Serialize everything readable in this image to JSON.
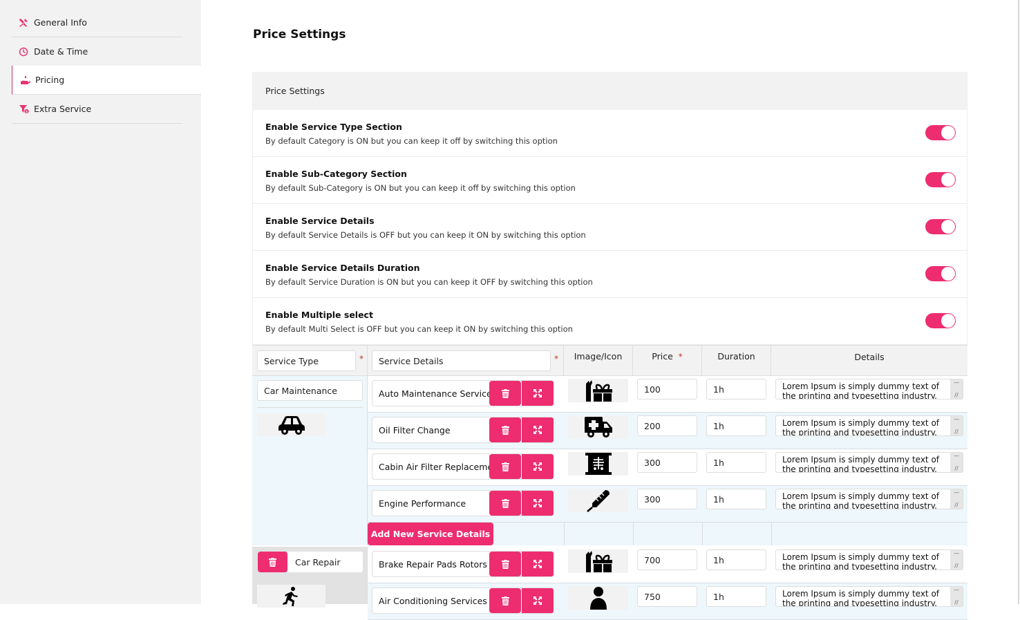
{
  "sidebar": {
    "items": [
      {
        "label": "General Info",
        "icon": "tools-icon",
        "active": false
      },
      {
        "label": "Date & Time",
        "icon": "clock-icon",
        "active": false
      },
      {
        "label": "Pricing",
        "icon": "hand-coin-icon",
        "active": true
      },
      {
        "label": "Extra Service",
        "icon": "funnel-dollar-icon",
        "active": false
      }
    ]
  },
  "page": {
    "title": "Price Settings"
  },
  "panel": {
    "title": "Price Settings",
    "options": [
      {
        "title": "Enable Service Type Section",
        "desc": "By default Category is ON but you can keep it off by switching this option",
        "on": true
      },
      {
        "title": "Enable Sub-Category Section",
        "desc": "By default Sub-Category is ON but you can keep it off by switching this option",
        "on": true
      },
      {
        "title": "Enable Service Details",
        "desc": "By default Service Details is OFF but you can keep it ON by switching this option",
        "on": true
      },
      {
        "title": "Enable Service Details Duration",
        "desc": "By default Service Duration is ON but you can keep it OFF by switching this option",
        "on": true
      },
      {
        "title": "Enable Multiple select",
        "desc": "By default Multi Select is OFF but you can keep it ON by switching this option",
        "on": true
      }
    ]
  },
  "table": {
    "headers": {
      "service_type": "Service Type",
      "service_details": "Service Details",
      "image": "Image/Icon",
      "price": "Price",
      "duration": "Duration",
      "details": "Details",
      "required_mark": "*"
    },
    "add_label": "Add New Service Details",
    "groups": [
      {
        "type": "Car Maintenance",
        "icon": "car-icon",
        "rows": [
          {
            "name": "Auto Maintenance Services",
            "icon": "gifts-icon",
            "price": "100",
            "duration": "1h",
            "details": "Lorem Ipsum is simply dummy text of the printing and typesetting industry."
          },
          {
            "name": "Oil Filter Change",
            "icon": "ambulance-icon",
            "price": "200",
            "duration": "1h",
            "details": "Lorem Ipsum is simply dummy text of the printing and typesetting industry."
          },
          {
            "name": "Cabin Air Filter Replacement",
            "icon": "x-ray-icon",
            "price": "300",
            "duration": "1h",
            "details": "Lorem Ipsum is simply dummy text of the printing and typesetting industry."
          },
          {
            "name": "Engine Performance",
            "icon": "thermometer-icon",
            "price": "300",
            "duration": "1h",
            "details": "Lorem Ipsum is simply dummy text of the printing and typesetting industry."
          }
        ]
      },
      {
        "type": "Car Repair",
        "icon": "running-icon",
        "rows": [
          {
            "name": "Brake Repair Pads Rotors",
            "icon": "gifts-icon",
            "price": "700",
            "duration": "1h",
            "details": "Lorem Ipsum is simply dummy text of the printing and typesetting industry."
          },
          {
            "name": "Air Conditioning Services",
            "icon": "user-md-icon",
            "price": "750",
            "duration": "1h",
            "details": "Lorem Ipsum is simply dummy text of the printing and typesetting industry."
          }
        ]
      }
    ]
  },
  "colors": {
    "accent": "#ed2d6f",
    "row_alt": "#eef7fb",
    "header_bg": "#f2f2f2"
  }
}
